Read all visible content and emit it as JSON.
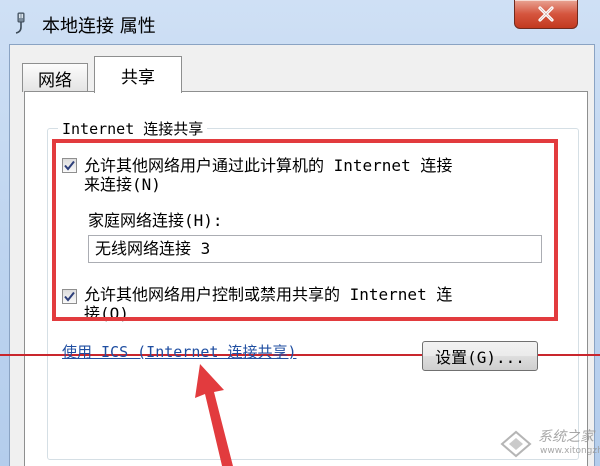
{
  "window": {
    "title": "本地连接 属性",
    "close_icon": "close-icon"
  },
  "tabs": [
    {
      "label": "网络",
      "active": false
    },
    {
      "label": "共享",
      "active": true
    }
  ],
  "sharing": {
    "group_title": "Internet 连接共享",
    "allow_share": {
      "checked": true,
      "line1": "允许其他网络用户通过此计算机的 Internet 连接",
      "line2": "来连接(N)"
    },
    "home_network_label": "家庭网络连接(H):",
    "home_network_value": "无线网络连接 3",
    "allow_control": {
      "checked": true,
      "line1": "允许其他网络用户控制或禁用共享的 Internet 连",
      "line2": "接(O)"
    },
    "ics_link": "使用 ICS (Internet 连接共享)",
    "settings_button": "设置(G)..."
  },
  "annotation": {
    "highlight_color": "#e23b3e",
    "arrow_color": "#e23b3e"
  },
  "watermark": {
    "text": "系统之家",
    "url": "www.xitongzhijia.net"
  }
}
